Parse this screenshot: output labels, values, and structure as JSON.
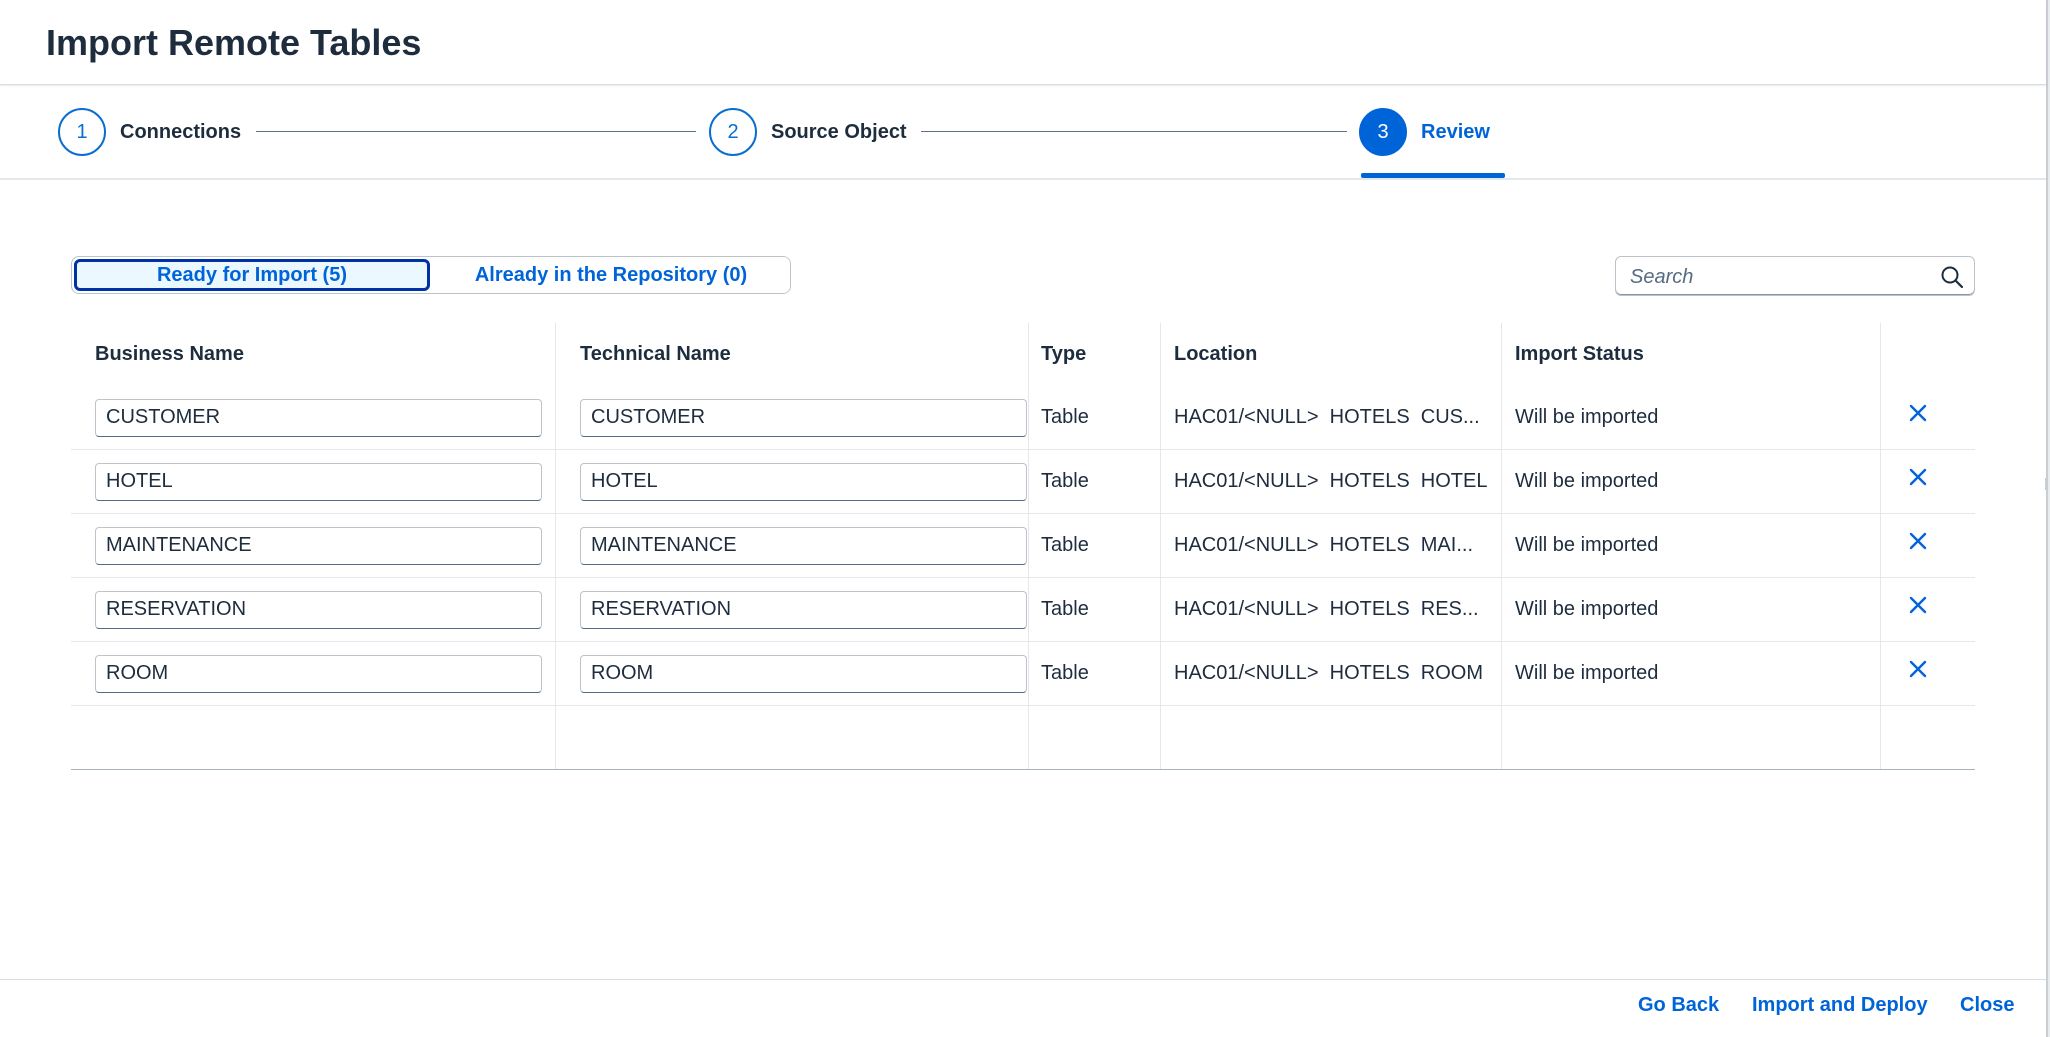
{
  "dialog": {
    "title": "Import Remote Tables"
  },
  "wizard": {
    "steps": [
      {
        "number": "1",
        "label": "Connections"
      },
      {
        "number": "2",
        "label": "Source Object"
      },
      {
        "number": "3",
        "label": "Review"
      }
    ],
    "active_step": "3"
  },
  "segmented": {
    "ready": "Ready for Import (5)",
    "repository": "Already in the Repository (0)"
  },
  "search": {
    "placeholder": "Search"
  },
  "table": {
    "headers": [
      "Business Name",
      "Technical Name",
      "Type",
      "Location",
      "Import Status",
      ""
    ],
    "rows": [
      {
        "business_name": "CUSTOMER",
        "technical_name": "CUSTOMER",
        "type": "Table",
        "location": "HAC01/<NULL>  HOTELS  CUS...",
        "status": "Will be imported"
      },
      {
        "business_name": "HOTEL",
        "technical_name": "HOTEL",
        "type": "Table",
        "location": "HAC01/<NULL>  HOTELS  HOTEL",
        "status": "Will be imported"
      },
      {
        "business_name": "MAINTENANCE",
        "technical_name": "MAINTENANCE",
        "type": "Table",
        "location": "HAC01/<NULL>  HOTELS  MAI...",
        "status": "Will be imported"
      },
      {
        "business_name": "RESERVATION",
        "technical_name": "RESERVATION",
        "type": "Table",
        "location": "HAC01/<NULL>  HOTELS  RES...",
        "status": "Will be imported"
      },
      {
        "business_name": "ROOM",
        "technical_name": "ROOM",
        "type": "Table",
        "location": "HAC01/<NULL>  HOTELS  ROOM",
        "status": "Will be imported"
      }
    ]
  },
  "footer": {
    "go_back": "Go Back",
    "import_deploy": "Import and Deploy",
    "close": "Close"
  },
  "colors": {
    "accent": "#0064d9",
    "selected_border": "#0032a5",
    "text": "#1d2d3e"
  },
  "icons": {
    "search": "search-icon",
    "remove": "close-icon"
  }
}
